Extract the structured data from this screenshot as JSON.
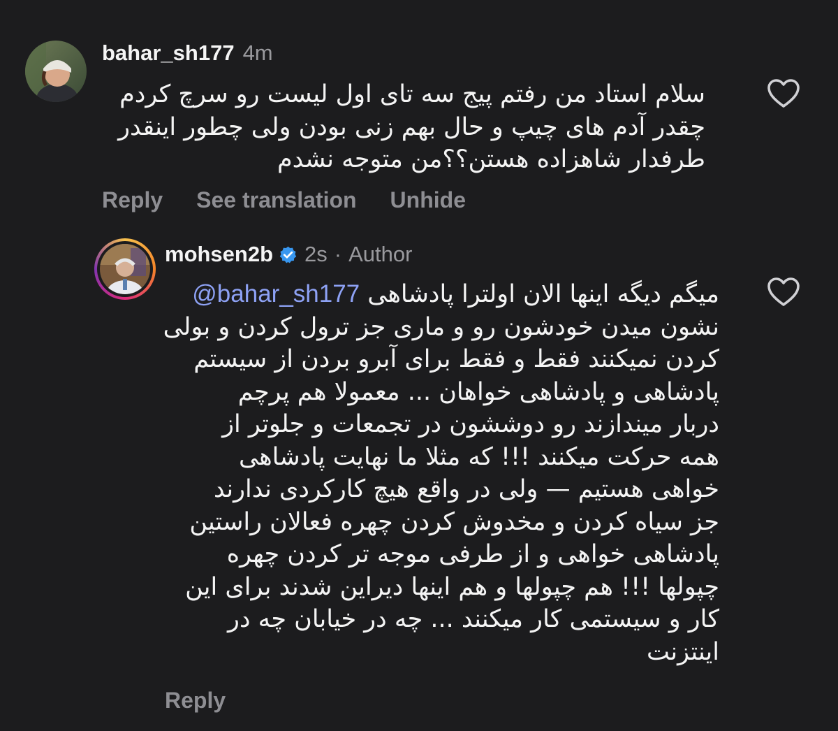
{
  "comments": [
    {
      "username": "bahar_sh177",
      "time": "4m",
      "lines": [
        "سلام استاد من رفتم پیج سه تای اول لیست رو سرچ کردم",
        "چقدر آدم های چیپ و حال بهم زنی بودن ولی چطور اینقدر",
        "طرفدار شاهزاده هستن؟؟من متوجه نشدم"
      ],
      "actions": [
        "Reply",
        "See translation",
        "Unhide"
      ],
      "like_icon": "heart-outline-icon"
    },
    {
      "username": "mohsen2b",
      "verified_icon": "verified-badge-icon",
      "time": "2s",
      "separator": "·",
      "badge": "Author",
      "mention": "@bahar_sh177",
      "first_line_text": "میگم دیگه اینها الان اولترا پادشاهی",
      "lines": [
        "نشون میدن خودشون رو و ماری جز ترول کردن و بولی",
        "کردن نمیکنند فقط و فقط برای آبرو بردن از سیستم",
        "پادشاهی و پادشاهی خواهان ... معمولا هم پرچم",
        "دربار میندازند رو دوششون در تجمعات و جلوتر از",
        "همه حرکت میکنند !!! که مثلا ما نهایت پادشاهی",
        "خواهی هستیم — ولی در واقع هیچ کارکردی ندارند",
        "جز سیاه کردن و مخدوش کردن چهره فعالان راستین",
        "پادشاهی خواهی و از طرفی موجه تر کردن چهره",
        "چپولها !!! هم چپولها و هم اینها دیراین شدند برای این",
        "کار و سیستمی کار میکنند ... چه در خیابان چه در",
        "اینتزنت"
      ],
      "actions": [
        "Reply"
      ],
      "like_icon": "heart-outline-icon"
    }
  ],
  "colors": {
    "background": "#1c1c1e",
    "mention": "#8ea2f5",
    "muted": "#8e8e93",
    "verified": "#3897f0"
  }
}
